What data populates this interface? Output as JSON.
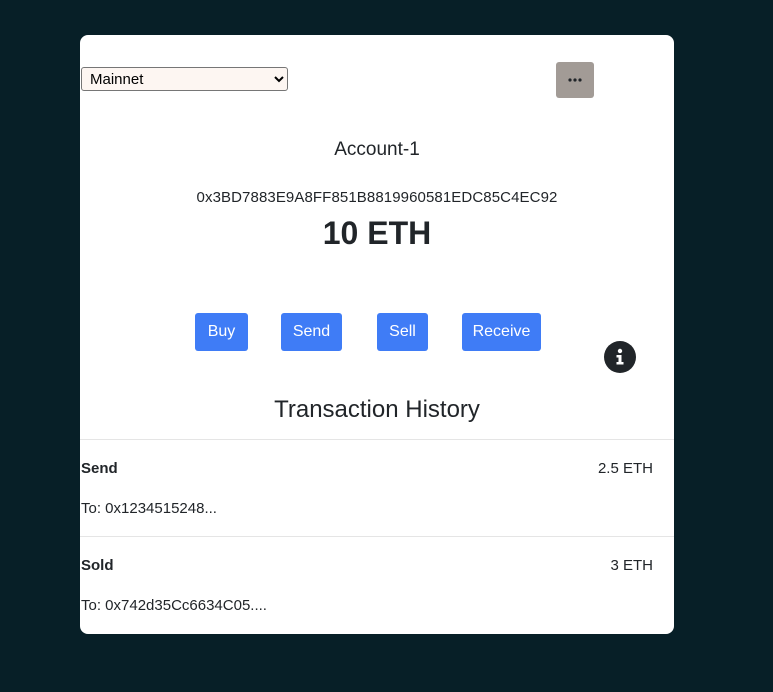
{
  "network": {
    "selected": "Mainnet",
    "options": [
      "Mainnet"
    ]
  },
  "menu": {
    "icon": "more-horizontal-icon"
  },
  "account": {
    "name": "Account-1",
    "address": "0x3BD7883E9A8FF851B8819960581EDC85C4EC92",
    "balance": "10 ETH"
  },
  "actions": {
    "buy": "Buy",
    "send": "Send",
    "sell": "Sell",
    "receive": "Receive"
  },
  "info": {
    "icon": "info-circle-icon"
  },
  "history": {
    "title": "Transaction History",
    "items": [
      {
        "type": "Send",
        "amount": "2.5 ETH",
        "to": "To: 0x1234515248..."
      },
      {
        "type": "Sold",
        "amount": "3 ETH",
        "to": "To: 0x742d35Cc6634C05...."
      }
    ]
  },
  "colors": {
    "page_background": "#071f27",
    "card_background": "#ffffff",
    "accent": "#3f7cf6",
    "menu_button": "#a29b96"
  }
}
